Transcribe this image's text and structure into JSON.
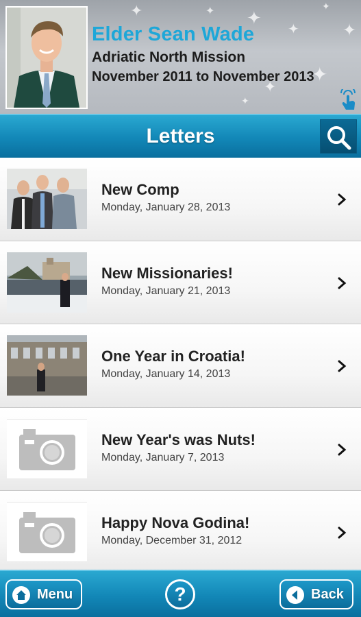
{
  "profile": {
    "name": "Elder Sean Wade",
    "mission": "Adriatic North Mission",
    "dates": "November 2011 to November 2013",
    "photo_icon": "portrait-photo",
    "tap_icon": "tap-hand-icon"
  },
  "title_bar": {
    "title": "Letters",
    "search_icon": "search-icon"
  },
  "letters": [
    {
      "title": "New Comp",
      "date": "Monday, January 28, 2013",
      "thumb": "photo-three-men"
    },
    {
      "title": "New Missionaries!",
      "date": "Monday, January 21, 2013",
      "thumb": "photo-castle-river"
    },
    {
      "title": "One Year in Croatia!",
      "date": "Monday, January 14, 2013",
      "thumb": "photo-amphitheater"
    },
    {
      "title": "New Year's was Nuts!",
      "date": "Monday, January 7, 2013",
      "thumb": "camera-placeholder"
    },
    {
      "title": "Happy Nova Godina!",
      "date": "Monday, December 31, 2012",
      "thumb": "camera-placeholder"
    }
  ],
  "bottom_bar": {
    "menu_label": "Menu",
    "help_glyph": "?",
    "back_label": "Back",
    "menu_icon": "home-icon",
    "back_icon": "back-arrow-icon"
  },
  "colors": {
    "accent_blue": "#1287b7",
    "name_blue": "#1ea7d8",
    "dark_button": "#064f72"
  }
}
